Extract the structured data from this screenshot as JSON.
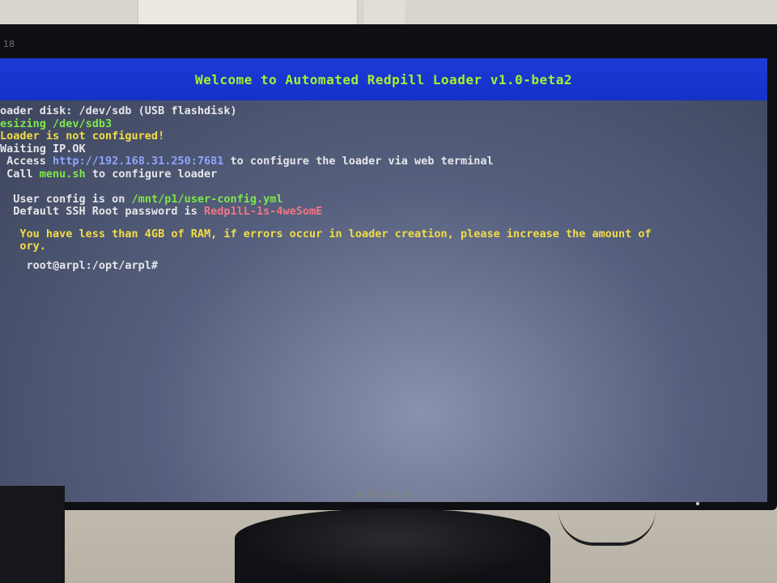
{
  "monitor": {
    "model_label": "18",
    "brand": "WASCOM"
  },
  "screen": {
    "title": "Welcome to Automated Redpill Loader v1.0-beta2",
    "lines": {
      "loader_disk": "oader disk: /dev/sdb (USB flashdisk)",
      "resizing": "esizing /dev/sdb3",
      "not_configured": "Loader is not configured!",
      "waiting_ip": "Waiting IP.OK",
      "access_prefix": " Access ",
      "access_url": "http://192.168.31.250:7681",
      "access_suffix": " to configure the loader via web terminal",
      "call_prefix": " Call ",
      "call_cmd": "menu.sh",
      "call_suffix": " to configure loader",
      "user_config_prefix": "  User config is on ",
      "user_config_path": "/mnt/p1/user-config.yml",
      "ssh_prefix": "  Default SSH Root password is ",
      "ssh_password": "Redp1lL-1s-4weSomE",
      "ram_warning_1": "   You have less than 4GB of RAM, if errors occur in loader creation, please increase the amount of",
      "ram_warning_2": "   ory.",
      "prompt": "    root@arpl:/opt/arpl#"
    }
  },
  "colors": {
    "title_bar": "#1432c8",
    "title_text": "#a6f030",
    "green": "#7ee84a",
    "yellow": "#f2dd46",
    "link": "#8fa4ff",
    "red": "#f37585"
  }
}
